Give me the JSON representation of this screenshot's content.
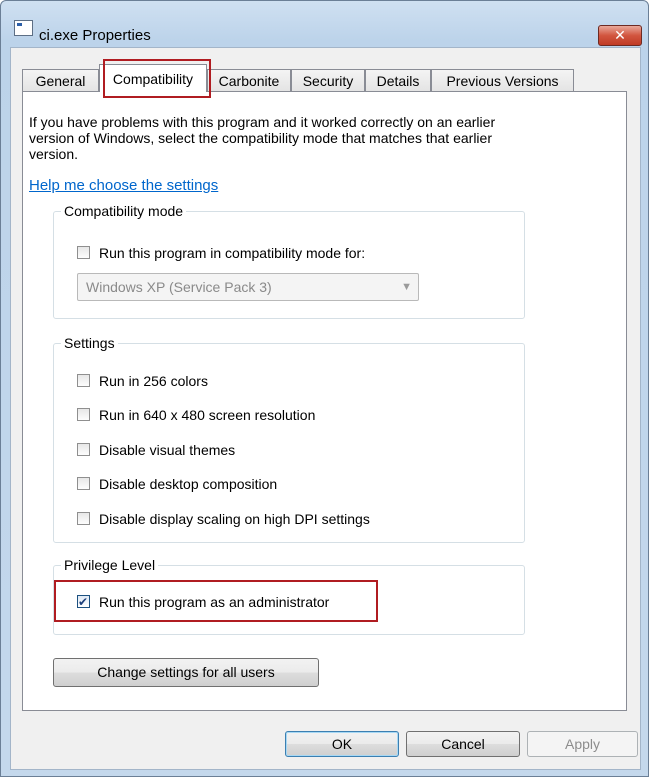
{
  "window": {
    "title": "ci.exe Properties",
    "close_label": "✕"
  },
  "tabs": [
    {
      "label": "General",
      "active": false
    },
    {
      "label": "Compatibility",
      "active": true
    },
    {
      "label": "Carbonite",
      "active": false
    },
    {
      "label": "Security",
      "active": false
    },
    {
      "label": "Details",
      "active": false
    },
    {
      "label": "Previous Versions",
      "active": false
    }
  ],
  "compat": {
    "intro": "If you have problems with this program and it worked correctly on an earlier version of Windows, select the compatibility mode that matches that earlier version.",
    "help_link": "Help me choose the settings",
    "mode_group": {
      "label": "Compatibility mode",
      "checkbox_label": "Run this program in compatibility mode for:",
      "checked": false,
      "selected_os": "Windows XP (Service Pack 3)"
    },
    "settings_group": {
      "label": "Settings",
      "items": [
        {
          "label": "Run in 256 colors",
          "checked": false
        },
        {
          "label": "Run in 640 x 480 screen resolution",
          "checked": false
        },
        {
          "label": "Disable visual themes",
          "checked": false
        },
        {
          "label": "Disable desktop composition",
          "checked": false
        },
        {
          "label": "Disable display scaling on high DPI settings",
          "checked": false
        }
      ]
    },
    "privilege_group": {
      "label": "Privilege Level",
      "checkbox_label": "Run this program as an administrator",
      "checked": true
    },
    "change_all_users_label": "Change settings for all users"
  },
  "footer": {
    "ok_label": "OK",
    "cancel_label": "Cancel",
    "apply_label": "Apply"
  },
  "colors": {
    "highlight": "#b01c21",
    "link": "#0066cc"
  }
}
